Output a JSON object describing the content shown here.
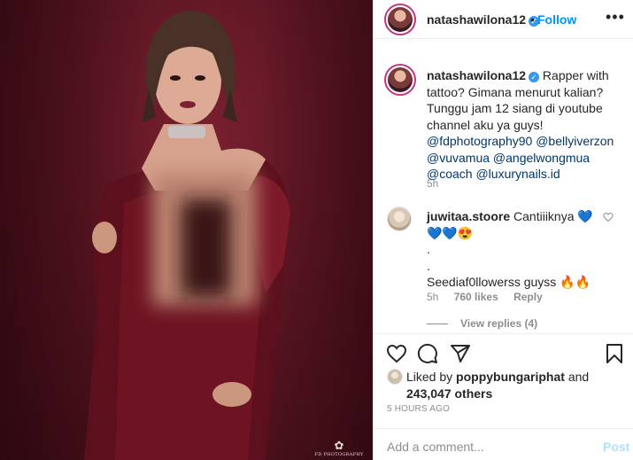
{
  "photo": {
    "credit_mark": "✿",
    "credit_text": "FD PHOTOGRAPHY"
  },
  "header": {
    "username": "natashawilona12",
    "verified_icon": "✓",
    "dot": "•",
    "follow_label": "Follow",
    "more_label": "•••"
  },
  "caption": {
    "username": "natashawilona12",
    "verified_icon": "✓",
    "text_1": " Rapper with tattoo? Gimana menurut kalian? Tunggu jam 12 siang di youtube channel aku ya guys!",
    "mentions": [
      "@fdphotography90",
      "@bellyiverzon",
      "@vuvamua",
      "@angelwongmua",
      "@coach",
      "@luxurynails.id"
    ],
    "time": "5h"
  },
  "comment": {
    "username": "juwitaa.stoore",
    "line_1": " Cantiiiknya 💙",
    "line_2": "💙💙😍",
    "line_3": ".",
    "line_4": ".",
    "line_5": "Seediaf0llowerss guyss 🔥🔥",
    "time": "5h",
    "likes": "760 likes",
    "reply_label": "Reply",
    "view_replies": "View replies (4)"
  },
  "likes": {
    "prefix": "Liked by ",
    "user": "poppybungariphat",
    "and": " and",
    "count": "243,047 others"
  },
  "timeago": "5 HOURS AGO",
  "add_comment": {
    "placeholder": "Add a comment...",
    "post_label": "Post"
  },
  "icons": {
    "heart": "heart-icon",
    "comment": "comment-icon",
    "share": "share-icon",
    "save": "bookmark-icon"
  },
  "colors": {
    "accent": "#0095f6",
    "verified": "#3897f0",
    "muted": "#8e8e8e",
    "text": "#262626",
    "post_disabled": "#b2dffc",
    "photo_bg": "#5a1522"
  }
}
